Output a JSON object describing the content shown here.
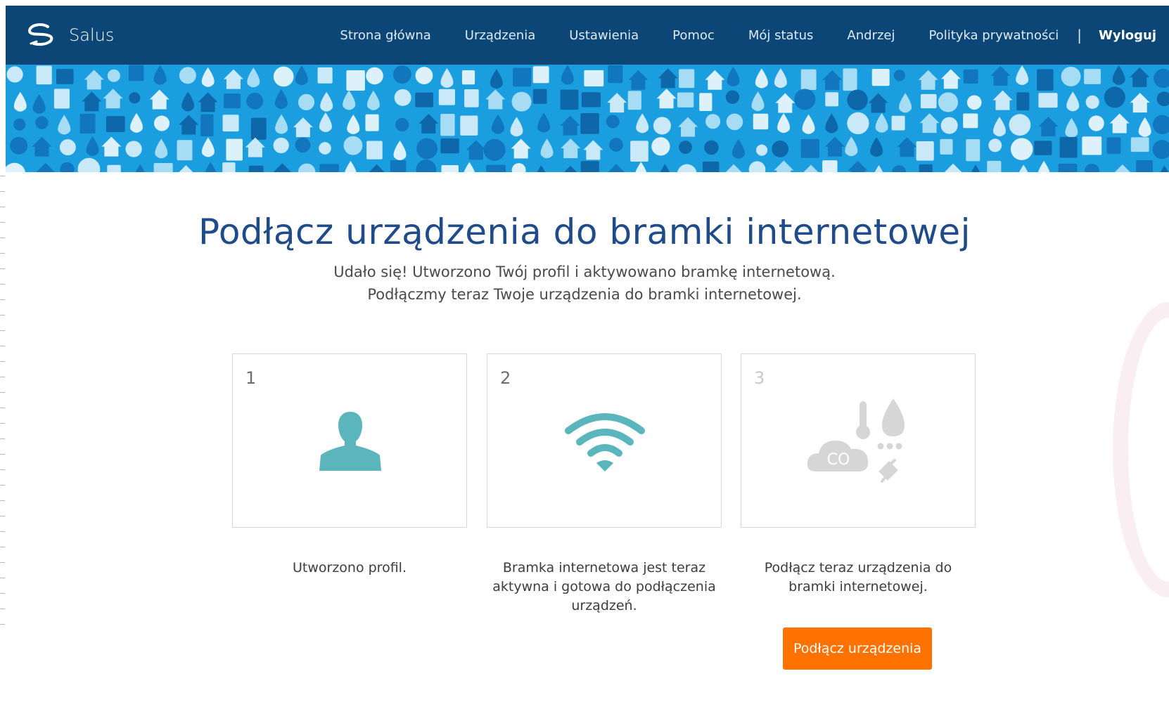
{
  "header": {
    "brand": "Salus",
    "nav": [
      {
        "label": "Strona główna"
      },
      {
        "label": "Urządzenia"
      },
      {
        "label": "Ustawienia"
      },
      {
        "label": "Pomoc"
      },
      {
        "label": "Mój status"
      },
      {
        "label": "Andrzej"
      },
      {
        "label": "Polityka prywatności"
      }
    ],
    "separator": "|",
    "logout": "Wyloguj"
  },
  "main": {
    "title": "Podłącz urządzenia do bramki internetowej",
    "subtitle_line1": "Udało się! Utworzono Twój profil i aktywowano bramkę internetową.",
    "subtitle_line2": "Podłączmy teraz Twoje urządzenia do bramki internetowej.",
    "steps": [
      {
        "number": "1",
        "icon": "user-icon",
        "description": "Utworzono profil."
      },
      {
        "number": "2",
        "icon": "wifi-icon",
        "description": "Bramka internetowa jest teraz aktywna i gotowa do podłączenia urządzeń."
      },
      {
        "number": "3",
        "icon": "devices-icon",
        "icon_text": "CO",
        "description": "Podłącz teraz urządzenia do bramki internetowej."
      }
    ],
    "connect_button": "Podłącz urządzenia"
  },
  "colors": {
    "navbar": "#0b4677",
    "banner": "#1b9ee0",
    "title": "#1f4b8a",
    "step_icon_active": "#5bb5bc",
    "step_icon_inactive": "#d6d6d6",
    "button": "#ff7200"
  }
}
